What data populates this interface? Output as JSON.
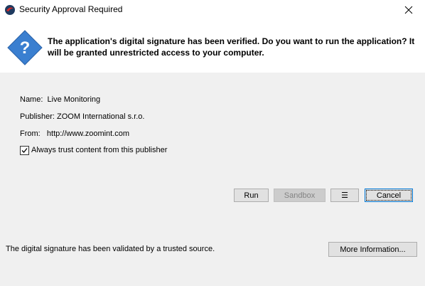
{
  "window": {
    "title": "Security Approval Required"
  },
  "header": {
    "message": "The application's digital signature has been verified. Do you want to run the application? It will be granted unrestricted access to your computer."
  },
  "info": {
    "name_label": "Name:",
    "name_value": "Live Monitoring",
    "publisher_label": "Publisher:",
    "publisher_value": "ZOOM International s.r.o.",
    "from_label": "From:",
    "from_value": "http://www.zoomint.com"
  },
  "trust": {
    "label": "Always trust content from this publisher",
    "checked": true
  },
  "buttons": {
    "run": "Run",
    "sandbox": "Sandbox",
    "menu": "☰",
    "cancel": "Cancel",
    "more_info": "More Information..."
  },
  "footer": {
    "message": "The digital signature has been validated by a trusted source."
  },
  "colors": {
    "question_icon": "#3a7fd0",
    "focus_border": "#0078d7"
  }
}
